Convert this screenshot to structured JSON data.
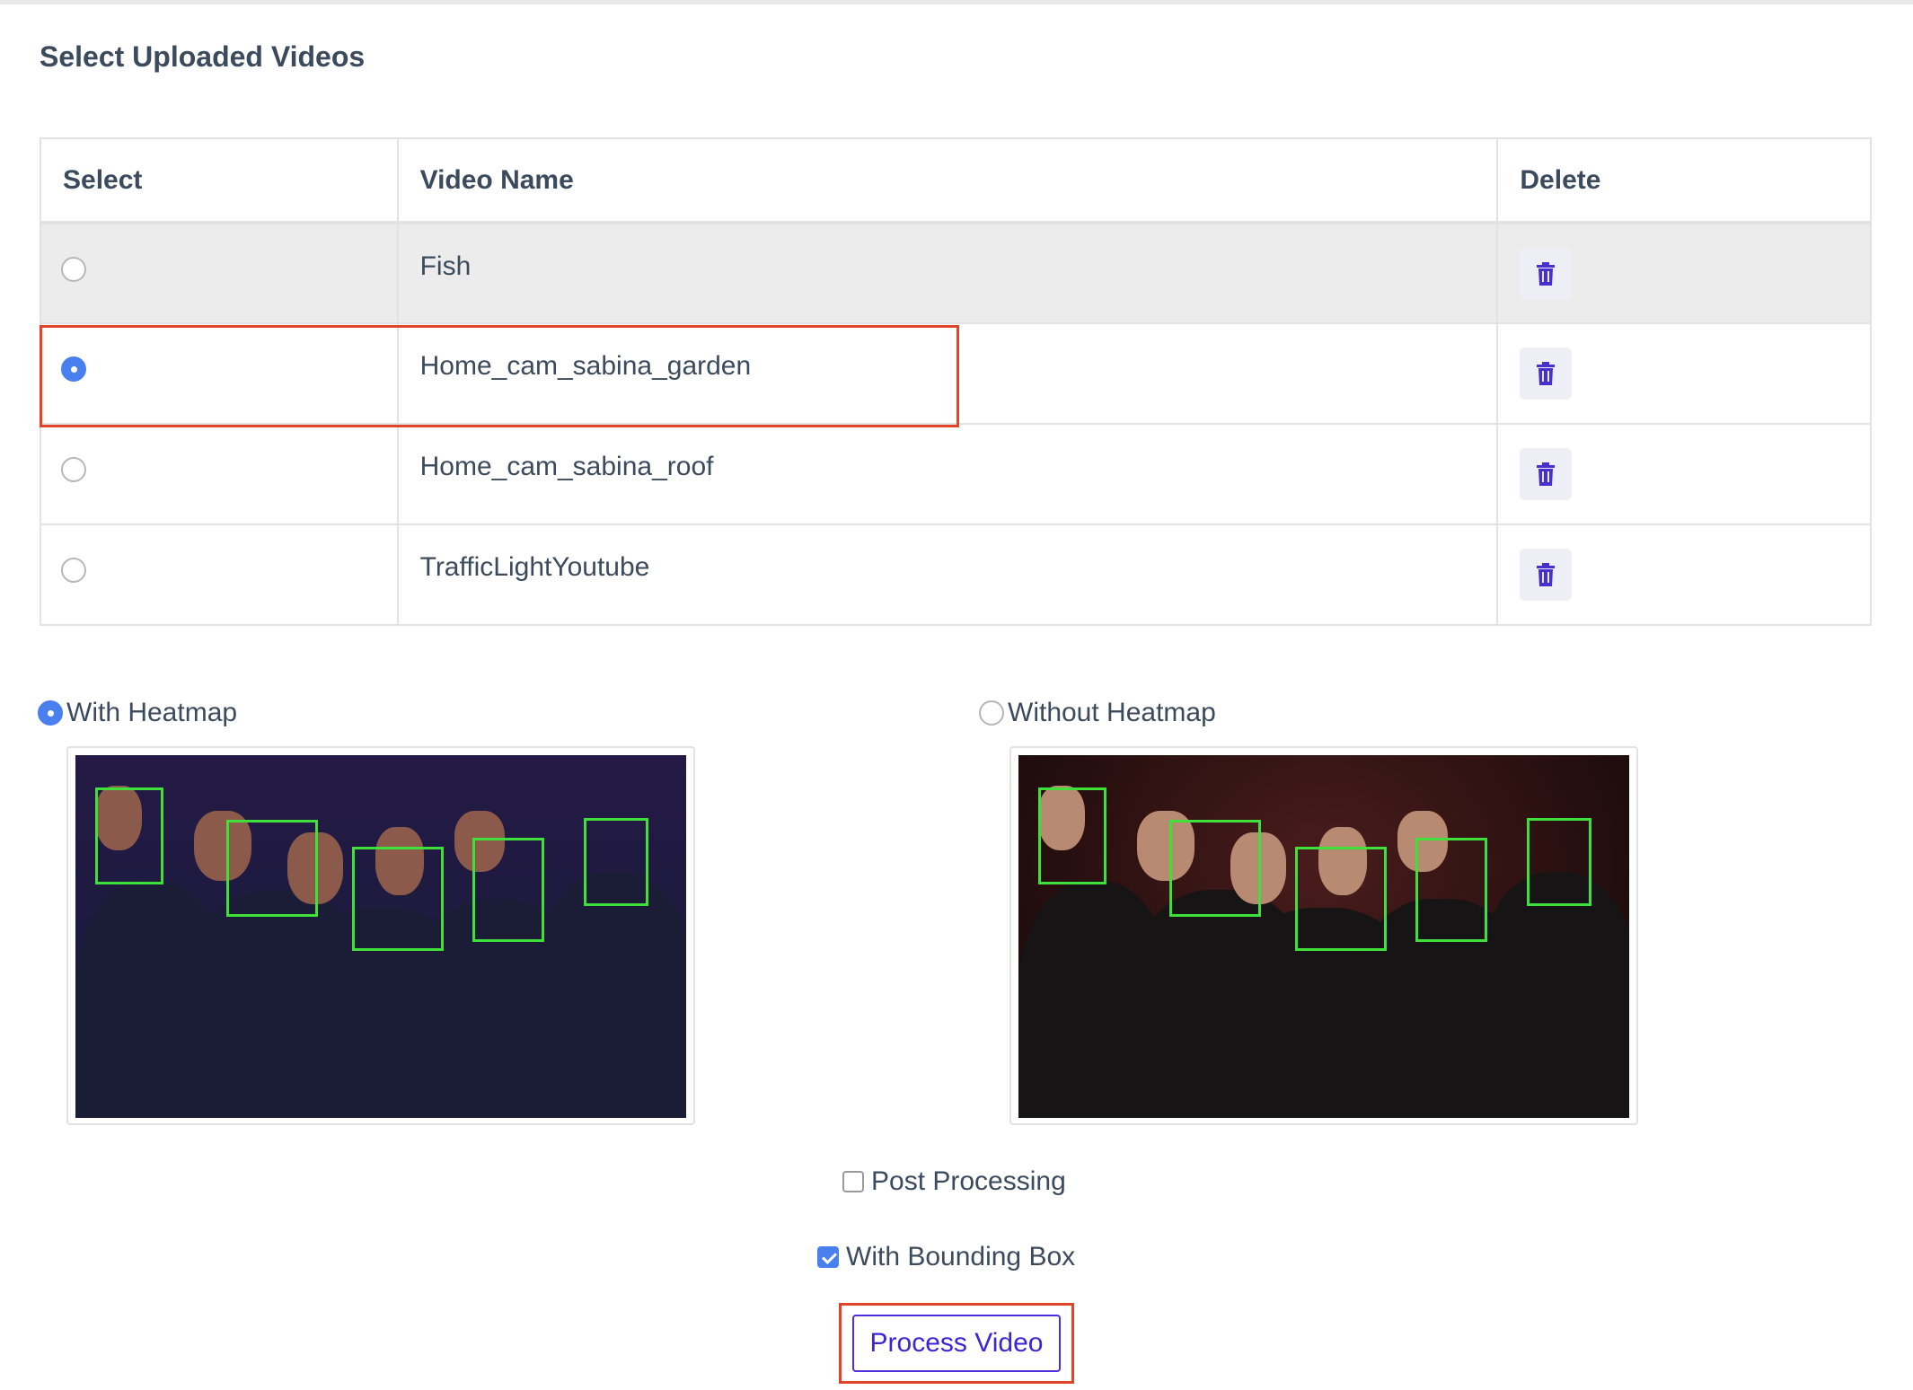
{
  "page": {
    "title": "Select Uploaded Videos"
  },
  "table": {
    "headers": {
      "select": "Select",
      "name": "Video Name",
      "delete": "Delete"
    },
    "rows": [
      {
        "name": "Fish",
        "selected": false
      },
      {
        "name": "Home_cam_sabina_garden",
        "selected": true
      },
      {
        "name": "Home_cam_sabina_roof",
        "selected": false
      },
      {
        "name": "TrafficLightYoutube",
        "selected": false
      }
    ]
  },
  "heatmap_options": {
    "with_label": "With Heatmap",
    "with_selected": true,
    "without_label": "Without Heatmap",
    "without_selected": false
  },
  "checkboxes": {
    "post_processing_label": "Post Processing",
    "post_processing_checked": false,
    "bounding_box_label": "With Bounding Box",
    "bounding_box_checked": true
  },
  "actions": {
    "process_label": "Process Video"
  },
  "colors": {
    "accent": "#4a7ff0",
    "highlight": "#e0452a",
    "button": "#3a25d8",
    "bbox": "#3fe03a"
  },
  "icons": {
    "delete": "trash-icon"
  }
}
